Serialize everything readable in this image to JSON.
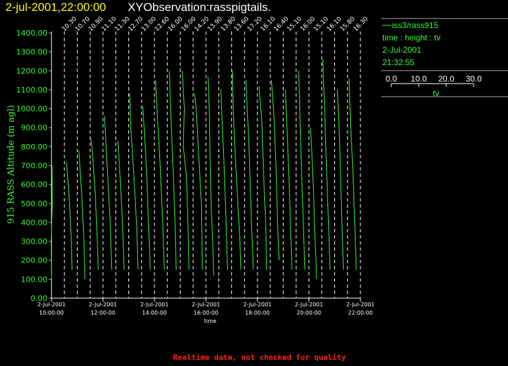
{
  "header": {
    "date": "2-jul-2001,22:00:00",
    "title": "XYObservation:rasspigtails."
  },
  "legend": {
    "series_name": "iss3/rass915",
    "line2": "time : height : tv",
    "line3": "2-Jul-2001",
    "line4": "21:32:55",
    "scale_ticks": [
      "0.0",
      "10.0",
      "20.0",
      "30.0"
    ],
    "scale_label": "tv"
  },
  "footer": "Realtime data, not checked for quality",
  "colors": {
    "series": "#33ff33",
    "axis": "#ffffff",
    "title": "#ffffff",
    "date": "#ffff00",
    "footer": "#ff2222"
  },
  "chart_data": {
    "type": "line",
    "ylabel": "915 RASS Altitude (m agl)",
    "xlabel": "time",
    "ylim": [
      0,
      1400
    ],
    "xlim_hours": [
      10.0,
      22.0
    ],
    "yticks": [
      "0.00",
      "100.00",
      "200.00",
      "300.00",
      "400.00",
      "500.00",
      "600.00",
      "700.00",
      "800.00",
      "900.00",
      "1000.00",
      "1100.00",
      "1200.00",
      "1300.00",
      "1400.00"
    ],
    "xticks": [
      {
        "date": "2-Jul-2001",
        "time": "10:00:00"
      },
      {
        "date": "2-Jul-2001",
        "time": "12:00:00"
      },
      {
        "date": "2-Jul-2001",
        "time": "14:00:00"
      },
      {
        "date": "2-Jul-2001",
        "time": "16:00:00"
      },
      {
        "date": "2-Jul-2001",
        "time": "18:00:00"
      },
      {
        "date": "2-Jul-2001",
        "time": "20:00:00"
      },
      {
        "date": "2-Jul-2001",
        "time": "22:00:00"
      }
    ],
    "grid": "vertical dashed at each profile time",
    "profile_times": [
      "10:00",
      "10:30",
      "11:00",
      "11:30",
      "12:00",
      "12:30",
      "13:00",
      "13:30",
      "14:00",
      "14:30",
      "15:00",
      "15:30",
      "16:00",
      "16:30",
      "17:00",
      "17:30",
      "18:00",
      "18:30",
      "19:00",
      "19:30",
      "20:00",
      "20:30",
      "21:00",
      "21:30",
      "22:00"
    ],
    "top_labels": [
      "10.30",
      "10.70",
      "10.90",
      "11.10",
      "11.30",
      "12.70",
      "13.00",
      "12.60",
      "16.00",
      "16.00",
      "14.20",
      "13.90",
      "13.80",
      "13.60",
      "17.20",
      "16.10",
      "16.40",
      "15.10",
      "16.00",
      "15.10",
      "16.10",
      "15.80",
      "16.30"
    ],
    "profiles": [
      {
        "t": 10.0,
        "pts": [
          [
            0.0,
            100
          ],
          [
            -0.3,
            300
          ],
          [
            0.8,
            500
          ],
          [
            0.5,
            700
          ]
        ]
      },
      {
        "t": 10.5,
        "pts": [
          [
            7.5,
            150
          ],
          [
            6.8,
            300
          ],
          [
            5.0,
            500
          ],
          [
            3.0,
            650
          ],
          [
            2.0,
            720
          ]
        ]
      },
      {
        "t": 11.0,
        "pts": [
          [
            7.5,
            100
          ],
          [
            6.5,
            300
          ],
          [
            4.8,
            500
          ],
          [
            2.5,
            700
          ],
          [
            1.5,
            780
          ]
        ]
      },
      {
        "t": 11.5,
        "pts": [
          [
            8.0,
            150
          ],
          [
            7.0,
            300
          ],
          [
            5.0,
            550
          ],
          [
            2.5,
            750
          ],
          [
            1.0,
            840
          ]
        ]
      },
      {
        "t": 12.0,
        "pts": [
          [
            8.5,
            150
          ],
          [
            7.0,
            400
          ],
          [
            4.5,
            650
          ],
          [
            2.5,
            850
          ],
          [
            1.5,
            960
          ]
        ]
      },
      {
        "t": 12.5,
        "pts": [
          [
            8.0,
            150
          ],
          [
            6.5,
            400
          ],
          [
            4.0,
            650
          ],
          [
            2.0,
            830
          ]
        ]
      },
      {
        "t": 13.0,
        "pts": [
          [
            9.0,
            150
          ],
          [
            8.0,
            350
          ],
          [
            5.0,
            650
          ],
          [
            2.0,
            900
          ],
          [
            1.0,
            1080
          ]
        ]
      },
      {
        "t": 13.5,
        "pts": [
          [
            8.5,
            150
          ],
          [
            7.0,
            350
          ],
          [
            5.0,
            650
          ],
          [
            2.5,
            900
          ],
          [
            1.0,
            1010
          ]
        ]
      },
      {
        "t": 14.0,
        "pts": [
          [
            9.5,
            150
          ],
          [
            8.0,
            400
          ],
          [
            5.5,
            700
          ],
          [
            3.0,
            950
          ],
          [
            1.0,
            1150
          ]
        ]
      },
      {
        "t": 14.5,
        "pts": [
          [
            8.5,
            150
          ],
          [
            7.5,
            400
          ],
          [
            5.5,
            700
          ],
          [
            3.5,
            950
          ],
          [
            2.0,
            1200
          ]
        ]
      },
      {
        "t": 15.0,
        "pts": [
          [
            8.5,
            150
          ],
          [
            7.5,
            400
          ],
          [
            6.0,
            650
          ],
          [
            3.0,
            800
          ],
          [
            4.0,
            1000
          ],
          [
            2.0,
            1200
          ]
        ]
      },
      {
        "t": 15.5,
        "pts": [
          [
            9.0,
            150
          ],
          [
            8.0,
            500
          ],
          [
            6.0,
            700
          ],
          [
            4.5,
            850
          ],
          [
            3.0,
            1000
          ],
          [
            1.5,
            1080
          ]
        ]
      },
      {
        "t": 16.0,
        "pts": [
          [
            7.5,
            120
          ],
          [
            6.5,
            300
          ],
          [
            5.0,
            500
          ],
          [
            4.0,
            750
          ],
          [
            3.5,
            950
          ],
          [
            2.0,
            1170
          ]
        ]
      },
      {
        "t": 16.5,
        "pts": [
          [
            8.5,
            150
          ],
          [
            7.0,
            400
          ],
          [
            5.5,
            650
          ],
          [
            3.5,
            900
          ],
          [
            2.5,
            1020
          ],
          [
            2.0,
            1100
          ]
        ]
      },
      {
        "t": 17.0,
        "pts": [
          [
            9.0,
            150
          ],
          [
            8.0,
            300
          ],
          [
            6.0,
            500
          ],
          [
            3.0,
            800
          ],
          [
            1.5,
            1000
          ],
          [
            0.5,
            1200
          ]
        ]
      },
      {
        "t": 17.5,
        "pts": [
          [
            8.5,
            150
          ],
          [
            7.0,
            350
          ],
          [
            5.5,
            600
          ],
          [
            4.0,
            850
          ],
          [
            2.5,
            1000
          ],
          [
            1.5,
            1150
          ]
        ]
      },
      {
        "t": 18.0,
        "pts": [
          [
            9.0,
            150
          ],
          [
            8.0,
            400
          ],
          [
            6.0,
            650
          ],
          [
            4.5,
            900
          ],
          [
            3.0,
            1020
          ],
          [
            1.5,
            1120
          ]
        ]
      },
      {
        "t": 18.5,
        "pts": [
          [
            8.5,
            200
          ],
          [
            7.0,
            400
          ],
          [
            5.5,
            700
          ],
          [
            4.0,
            900
          ],
          [
            2.5,
            1050
          ],
          [
            1.0,
            1150
          ]
        ]
      },
      {
        "t": 19.0,
        "pts": [
          [
            8.5,
            150
          ],
          [
            7.0,
            400
          ],
          [
            5.5,
            650
          ],
          [
            4.0,
            850
          ],
          [
            3.0,
            1000
          ],
          [
            2.0,
            1100
          ]
        ]
      },
      {
        "t": 19.5,
        "pts": [
          [
            8.5,
            150
          ],
          [
            7.0,
            400
          ],
          [
            5.5,
            650
          ],
          [
            4.0,
            900
          ],
          [
            3.5,
            1050
          ],
          [
            2.5,
            1200
          ]
        ]
      },
      {
        "t": 20.0,
        "pts": [
          [
            7.5,
            100
          ],
          [
            6.0,
            300
          ],
          [
            4.5,
            550
          ],
          [
            3.0,
            750
          ],
          [
            1.5,
            900
          ]
        ]
      },
      {
        "t": 20.5,
        "pts": [
          [
            8.0,
            150
          ],
          [
            6.5,
            400
          ],
          [
            4.5,
            700
          ],
          [
            3.0,
            950
          ],
          [
            1.0,
            1260
          ]
        ]
      },
      {
        "t": 21.0,
        "pts": [
          [
            8.5,
            150
          ],
          [
            7.0,
            400
          ],
          [
            5.5,
            700
          ],
          [
            4.0,
            950
          ],
          [
            2.5,
            1100
          ]
        ]
      },
      {
        "t": 21.5,
        "pts": [
          [
            8.5,
            150
          ],
          [
            7.0,
            400
          ],
          [
            5.0,
            700
          ],
          [
            3.0,
            900
          ],
          [
            1.5,
            1160
          ]
        ]
      }
    ]
  }
}
